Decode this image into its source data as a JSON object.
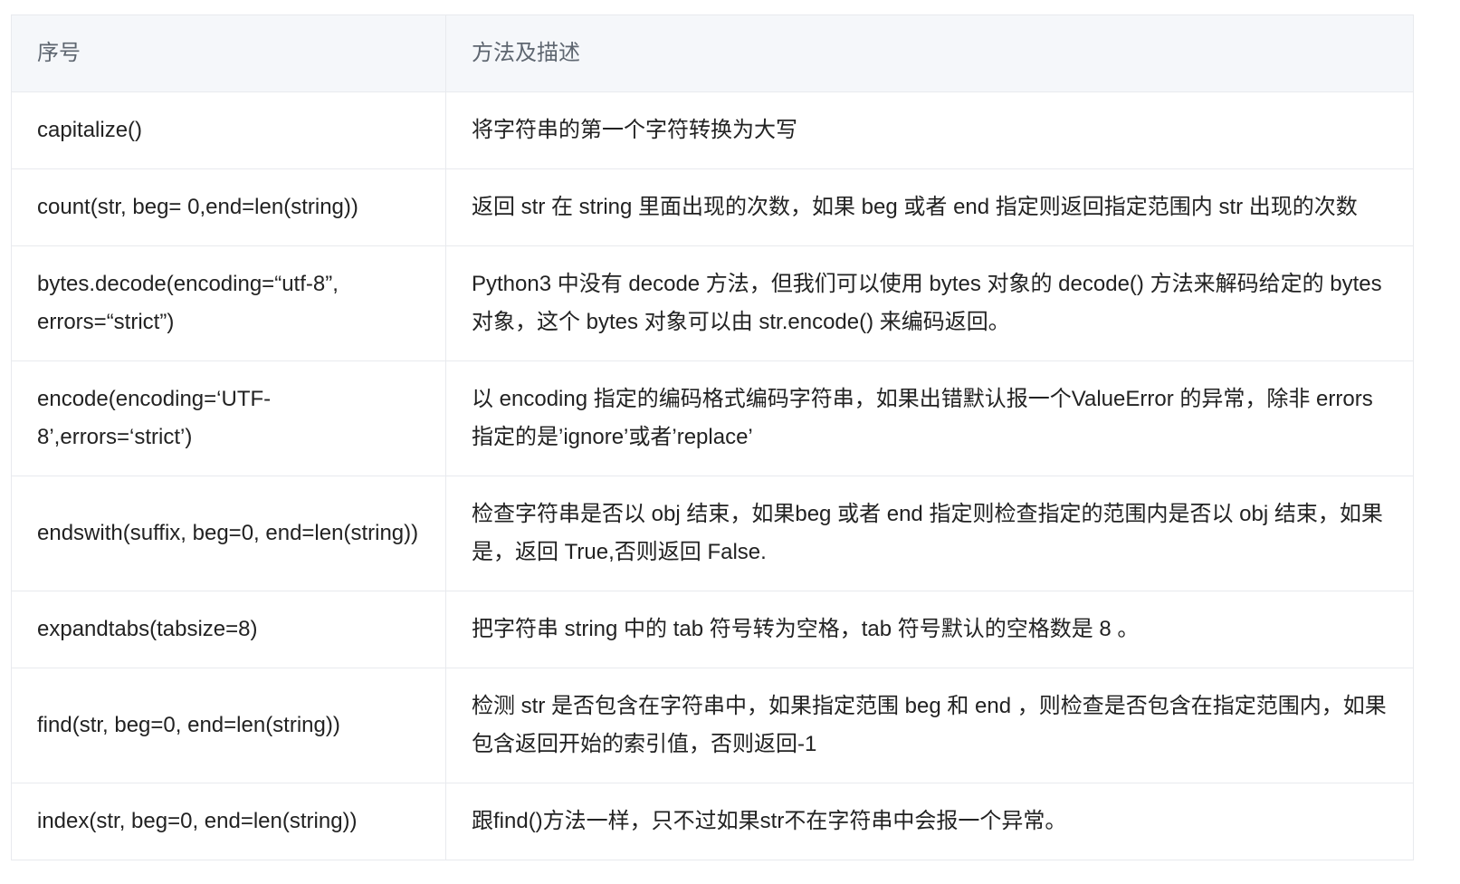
{
  "table": {
    "headers": [
      "序号",
      "方法及描述"
    ],
    "rows": [
      {
        "method": "capitalize()",
        "desc": "将字符串的第一个字符转换为大写"
      },
      {
        "method": "count(str, beg= 0,end=len(string))",
        "desc": "返回 str 在 string 里面出现的次数，如果 beg 或者 end 指定则返回指定范围内 str 出现的次数"
      },
      {
        "method": "bytes.decode(encoding=“utf-8”, errors=“strict”)",
        "desc": "Python3 中没有 decode 方法，但我们可以使用 bytes 对象的 decode() 方法来解码给定的 bytes 对象，这个 bytes 对象可以由 str.encode() 来编码返回。"
      },
      {
        "method": "encode(encoding=‘UTF-8’,errors=‘strict’)",
        "desc": "以 encoding 指定的编码格式编码字符串，如果出错默认报一个ValueError 的异常，除非 errors 指定的是’ignore’或者’replace’"
      },
      {
        "method": "endswith(suffix, beg=0, end=len(string))",
        "desc": "检查字符串是否以 obj 结束，如果beg 或者 end 指定则检查指定的范围内是否以 obj 结束，如果是，返回 True,否则返回 False."
      },
      {
        "method": "expandtabs(tabsize=8)",
        "desc": "把字符串 string 中的 tab 符号转为空格，tab 符号默认的空格数是 8 。"
      },
      {
        "method": "find(str, beg=0, end=len(string))",
        "desc": "检测 str 是否包含在字符串中，如果指定范围 beg 和 end ，则检查是否包含在指定范围内，如果包含返回开始的索引值，否则返回-1"
      },
      {
        "method": "index(str, beg=0, end=len(string))",
        "desc": "跟find()方法一样，只不过如果str不在字符串中会报一个异常。"
      }
    ]
  }
}
